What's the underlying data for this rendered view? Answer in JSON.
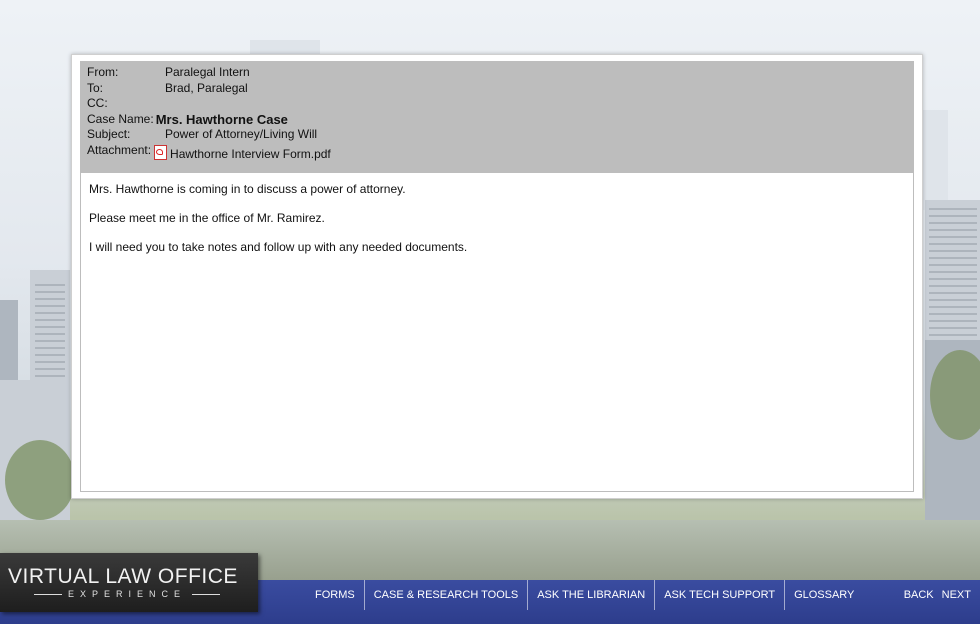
{
  "email": {
    "from_label": "From:",
    "from_value": "Paralegal Intern",
    "to_label": "To:",
    "to_value": "Brad, Paralegal",
    "cc_label": "CC:",
    "cc_value": "",
    "case_label": "Case Name:",
    "case_value": "Mrs. Hawthorne Case",
    "subject_label": "Subject:",
    "subject_value": "Power of Attorney/Living Will",
    "attachment_label": "Attachment:",
    "attachment_value": "Hawthorne Interview Form.pdf",
    "attachment_icon": "pdf-icon",
    "body": [
      "Mrs. Hawthorne is coming in to discuss a power of attorney.",
      "Please meet me in the office of Mr. Ramirez.",
      "I will need you to take notes and follow up with any needed documents."
    ]
  },
  "logo": {
    "title": "VIRTUAL LAW OFFICE",
    "subtitle": "EXPERIENCE"
  },
  "nav": {
    "items": [
      "FORMS",
      "CASE & RESEARCH TOOLS",
      "ASK THE LIBRARIAN",
      "ASK TECH SUPPORT",
      "GLOSSARY"
    ],
    "back": "BACK",
    "next": "NEXT"
  },
  "colors": {
    "nav_bg": "#2d3d8c",
    "header_bg": "#bdbdbd"
  }
}
